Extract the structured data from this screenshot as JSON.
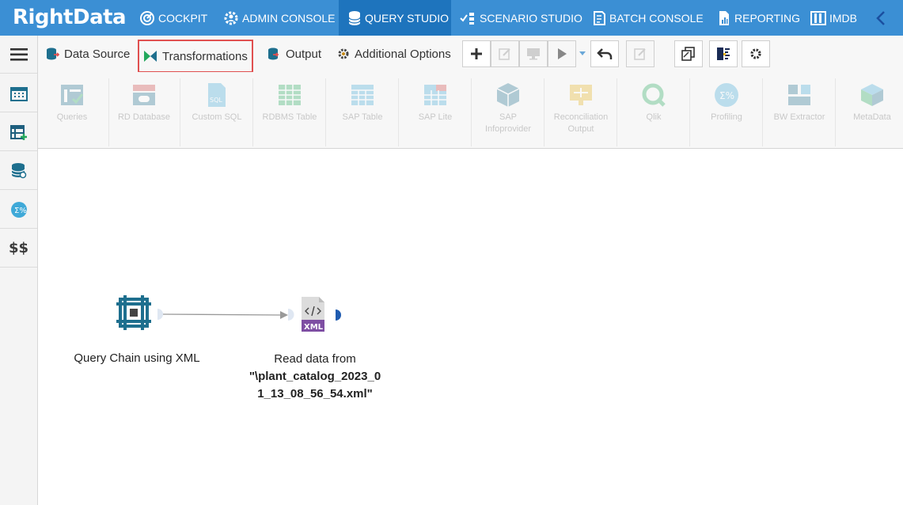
{
  "brand": {
    "name_prefix": "Right",
    "name_suffix": "Data"
  },
  "topnav": {
    "items": [
      {
        "label": "COCKPIT",
        "icon": "cockpit-icon"
      },
      {
        "label": "ADMIN CONSOLE",
        "icon": "gear-user-icon"
      },
      {
        "label": "QUERY STUDIO",
        "icon": "database-icon",
        "active": true
      },
      {
        "label": "SCENARIO STUDIO",
        "icon": "scenario-icon"
      },
      {
        "label": "BATCH CONSOLE",
        "icon": "batch-icon"
      },
      {
        "label": "REPORTING",
        "icon": "report-icon"
      },
      {
        "label": "IMDB",
        "icon": "imdb-icon"
      }
    ]
  },
  "sidebar": {
    "items": [
      {
        "icon": "menu-icon"
      },
      {
        "icon": "calendar-icon"
      },
      {
        "icon": "table-add-icon"
      },
      {
        "icon": "database-search-icon"
      },
      {
        "icon": "sigma-icon"
      },
      {
        "icon": "dollar-icon",
        "label": "$$"
      }
    ]
  },
  "toolbar": {
    "tabs": {
      "data_source": "Data Source",
      "transformations": "Transformations",
      "output": "Output",
      "additional_options": "Additional Options"
    }
  },
  "palette": {
    "items": [
      {
        "label": "Queries"
      },
      {
        "label": "RD Database"
      },
      {
        "label": "Custom SQL"
      },
      {
        "label": "RDBMS Table"
      },
      {
        "label": "SAP Table"
      },
      {
        "label": "SAP Lite"
      },
      {
        "label": "SAP\nInfoprovider"
      },
      {
        "label": "Reconciliation\nOutput"
      },
      {
        "label": "Qlik"
      },
      {
        "label": "Profiling"
      },
      {
        "label": "BW Extractor"
      },
      {
        "label": "MetaData"
      }
    ]
  },
  "canvas": {
    "node1": {
      "label": "Query Chain using XML"
    },
    "node2": {
      "label_line1": "Read data from",
      "label_line2": "\"\\plant_catalog_2023_0",
      "label_line3": "1_13_08_56_54.xml\"",
      "badge": "XML"
    }
  },
  "colors": {
    "nav": "#3b8fd4",
    "nav_active": "#1e74bd",
    "node_teal": "#1e6f8e",
    "highlight": "#e05050"
  }
}
